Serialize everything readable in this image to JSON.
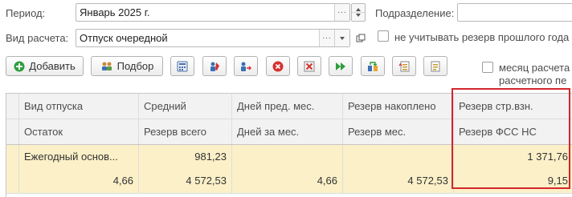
{
  "form": {
    "period_label": "Период:",
    "period_value": "Январь 2025 г.",
    "division_label": "Подразделение:",
    "division_value": "",
    "calc_label": "Вид расчета:",
    "calc_value": "Отпуск очередной",
    "reserve_checkbox_label": "не учитывать резерв прошлого года",
    "reserve_checkbox_checked": false,
    "month_checkbox_label_line1": "месяц расчета",
    "month_checkbox_label_line2": "расчетного пе",
    "month_checkbox_checked": false
  },
  "toolbar": {
    "add_label": "Добавить",
    "pick_label": "Подбор",
    "icons": [
      "calculator-icon",
      "edit-person-icon",
      "assign-icon",
      "stop-icon",
      "clear-icon",
      "fast-forward-icon",
      "transfer-icon",
      "list-up-icon",
      "list-settings-icon"
    ]
  },
  "table": {
    "header_row1": [
      "Вид отпуска",
      "Средний",
      "Дней пред. мес.",
      "Резерв накоплено",
      "Резерв стр.взн."
    ],
    "header_row2": [
      "Остаток",
      "Резерв всего",
      "Дней за мес.",
      "Резерв мес.",
      "Резерв ФСС НС"
    ],
    "rows": [
      {
        "line1": [
          "Ежегодный основ...",
          "981,23",
          "",
          "",
          "1 371,76"
        ],
        "line2": [
          "4,66",
          "4 572,53",
          "4,66",
          "4 572,53",
          "9,15"
        ]
      }
    ]
  },
  "colors": {
    "highlight_row": "#fbf0c8",
    "callout_border": "#d3272b",
    "add_icon": "#2e9e3e",
    "stop_icon": "#d8302f"
  }
}
